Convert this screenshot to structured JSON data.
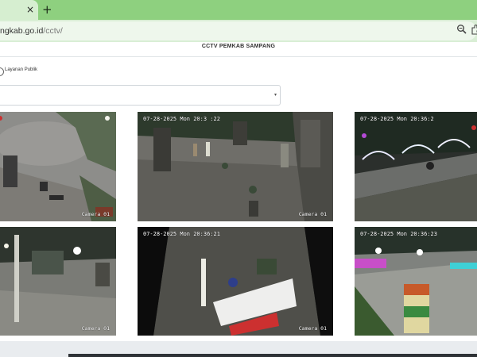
{
  "browser": {
    "tab": {
      "close_icon": "×"
    },
    "new_tab_icon": "+",
    "url": {
      "domain": "ngkab.go.id",
      "path": "/cctv/"
    },
    "icons": [
      "zoom-icon",
      "extension-icon"
    ]
  },
  "page": {
    "title": "CCTV PEMKAB SAMPANG",
    "filter": {
      "radio_label": "Layanan Publik",
      "select_value": ""
    }
  },
  "cameras": [
    {
      "timestamp": "",
      "label": "Camera 01",
      "scene": "day plaza"
    },
    {
      "timestamp": "07-28-2025 Mon 20:3 :22",
      "label": "Camera 01",
      "scene": "park"
    },
    {
      "timestamp": "07-28-2025 Mon 20:36:2",
      "label": "",
      "scene": "road"
    },
    {
      "timestamp": "",
      "label": "Camera 01",
      "scene": "night street"
    },
    {
      "timestamp": "07-28-2025 Mon 20:36:21",
      "label": "Camera 01",
      "scene": "sign"
    },
    {
      "timestamp": "07-28-2025 Mon 20:36:23",
      "label": "",
      "scene": "lights"
    }
  ],
  "colors": {
    "tab_bar": "#8ed07f",
    "toolbar": "#d9eed5",
    "page_bg": "#ffffff"
  }
}
